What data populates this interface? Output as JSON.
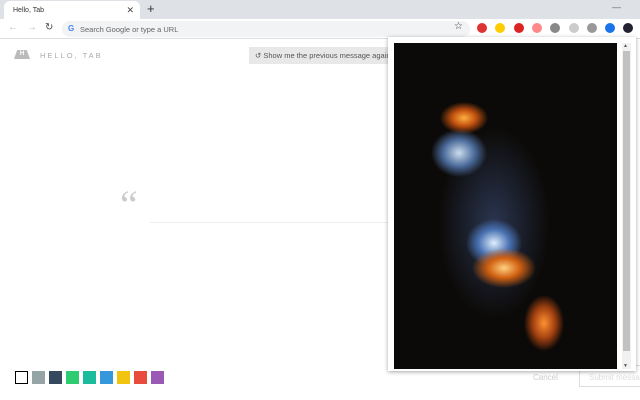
{
  "browser": {
    "tab_title": "Hello, Tab",
    "omnibox_placeholder": "Search Google or type a URL"
  },
  "extensions": [
    "red-flag-icon",
    "smiley-icon",
    "adblock-icon",
    "red-arrow-icon",
    "toggle-icon",
    "grey-icon",
    "troll-face-icon",
    "blue-drop-icon",
    "hello-tab-icon"
  ],
  "page": {
    "brand": "HELLO, TAB",
    "logo_letter": "H",
    "previous_button": "Show me the previous message again",
    "quote_mark": "“",
    "cancel": "Cancel",
    "submit": "Submit message"
  },
  "swatches": [
    "#ffffff",
    "#95a5a6",
    "#34495e",
    "#2ecc71",
    "#1abc9c",
    "#3498db",
    "#f1c40f",
    "#e74c3c",
    "#9b59b6"
  ]
}
